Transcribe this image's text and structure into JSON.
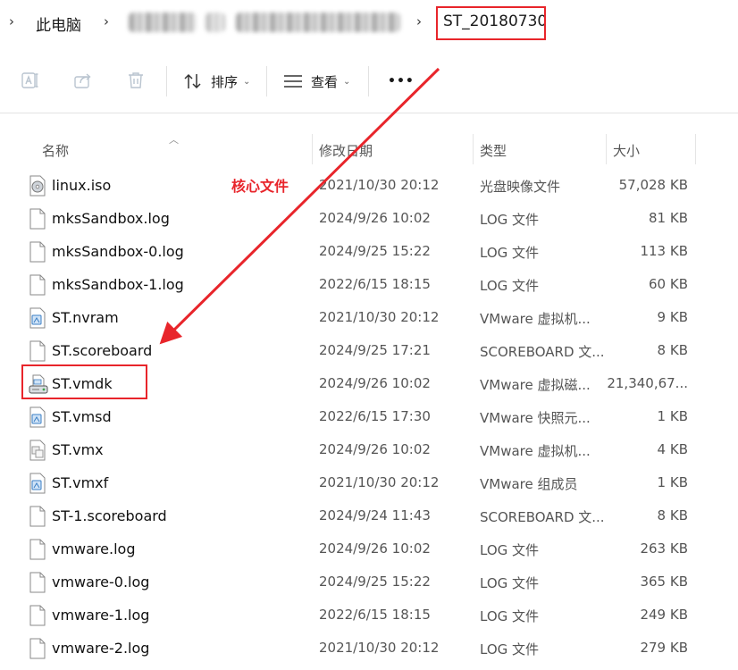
{
  "breadcrumb": {
    "root_label": "此电脑",
    "current_folder": "ST_20180730"
  },
  "toolbar": {
    "sort_label": "排序",
    "view_label": "查看",
    "more_label": "•••"
  },
  "columns": {
    "name": "名称",
    "date": "修改日期",
    "type": "类型",
    "size": "大小"
  },
  "annotation": {
    "label": "核心文件",
    "highlighted_file": "ST.vmdk",
    "color": "#e8252b"
  },
  "files": [
    {
      "name": "linux.iso",
      "date": "2021/10/30 20:12",
      "type": "光盘映像文件",
      "size": "57,028 KB",
      "icon": "disc-image-icon"
    },
    {
      "name": "mksSandbox.log",
      "date": "2024/9/26 10:02",
      "type": "LOG 文件",
      "size": "81 KB",
      "icon": "document-icon"
    },
    {
      "name": "mksSandbox-0.log",
      "date": "2024/9/25 15:22",
      "type": "LOG 文件",
      "size": "113 KB",
      "icon": "document-icon"
    },
    {
      "name": "mksSandbox-1.log",
      "date": "2022/6/15 18:15",
      "type": "LOG 文件",
      "size": "60 KB",
      "icon": "document-icon"
    },
    {
      "name": "ST.nvram",
      "date": "2021/10/30 20:12",
      "type": "VMware 虚拟机...",
      "size": "9 KB",
      "icon": "vmware-file-icon"
    },
    {
      "name": "ST.scoreboard",
      "date": "2024/9/25 17:21",
      "type": "SCOREBOARD 文...",
      "size": "8 KB",
      "icon": "document-icon"
    },
    {
      "name": "ST.vmdk",
      "date": "2024/9/26 10:02",
      "type": "VMware 虚拟磁...",
      "size": "21,340,67...",
      "icon": "virtual-disk-icon"
    },
    {
      "name": "ST.vmsd",
      "date": "2022/6/15 17:30",
      "type": "VMware 快照元...",
      "size": "1 KB",
      "icon": "vmware-file-icon"
    },
    {
      "name": "ST.vmx",
      "date": "2024/9/26 10:02",
      "type": "VMware 虚拟机...",
      "size": "4 KB",
      "icon": "vmx-config-icon"
    },
    {
      "name": "ST.vmxf",
      "date": "2021/10/30 20:12",
      "type": "VMware 组成员",
      "size": "1 KB",
      "icon": "vmware-file-icon"
    },
    {
      "name": "ST-1.scoreboard",
      "date": "2024/9/24 11:43",
      "type": "SCOREBOARD 文...",
      "size": "8 KB",
      "icon": "document-icon"
    },
    {
      "name": "vmware.log",
      "date": "2024/9/26 10:02",
      "type": "LOG 文件",
      "size": "263 KB",
      "icon": "document-icon"
    },
    {
      "name": "vmware-0.log",
      "date": "2024/9/25 15:22",
      "type": "LOG 文件",
      "size": "365 KB",
      "icon": "document-icon"
    },
    {
      "name": "vmware-1.log",
      "date": "2022/6/15 18:15",
      "type": "LOG 文件",
      "size": "249 KB",
      "icon": "document-icon"
    },
    {
      "name": "vmware-2.log",
      "date": "2021/10/30 20:12",
      "type": "LOG 文件",
      "size": "279 KB",
      "icon": "document-icon"
    }
  ]
}
